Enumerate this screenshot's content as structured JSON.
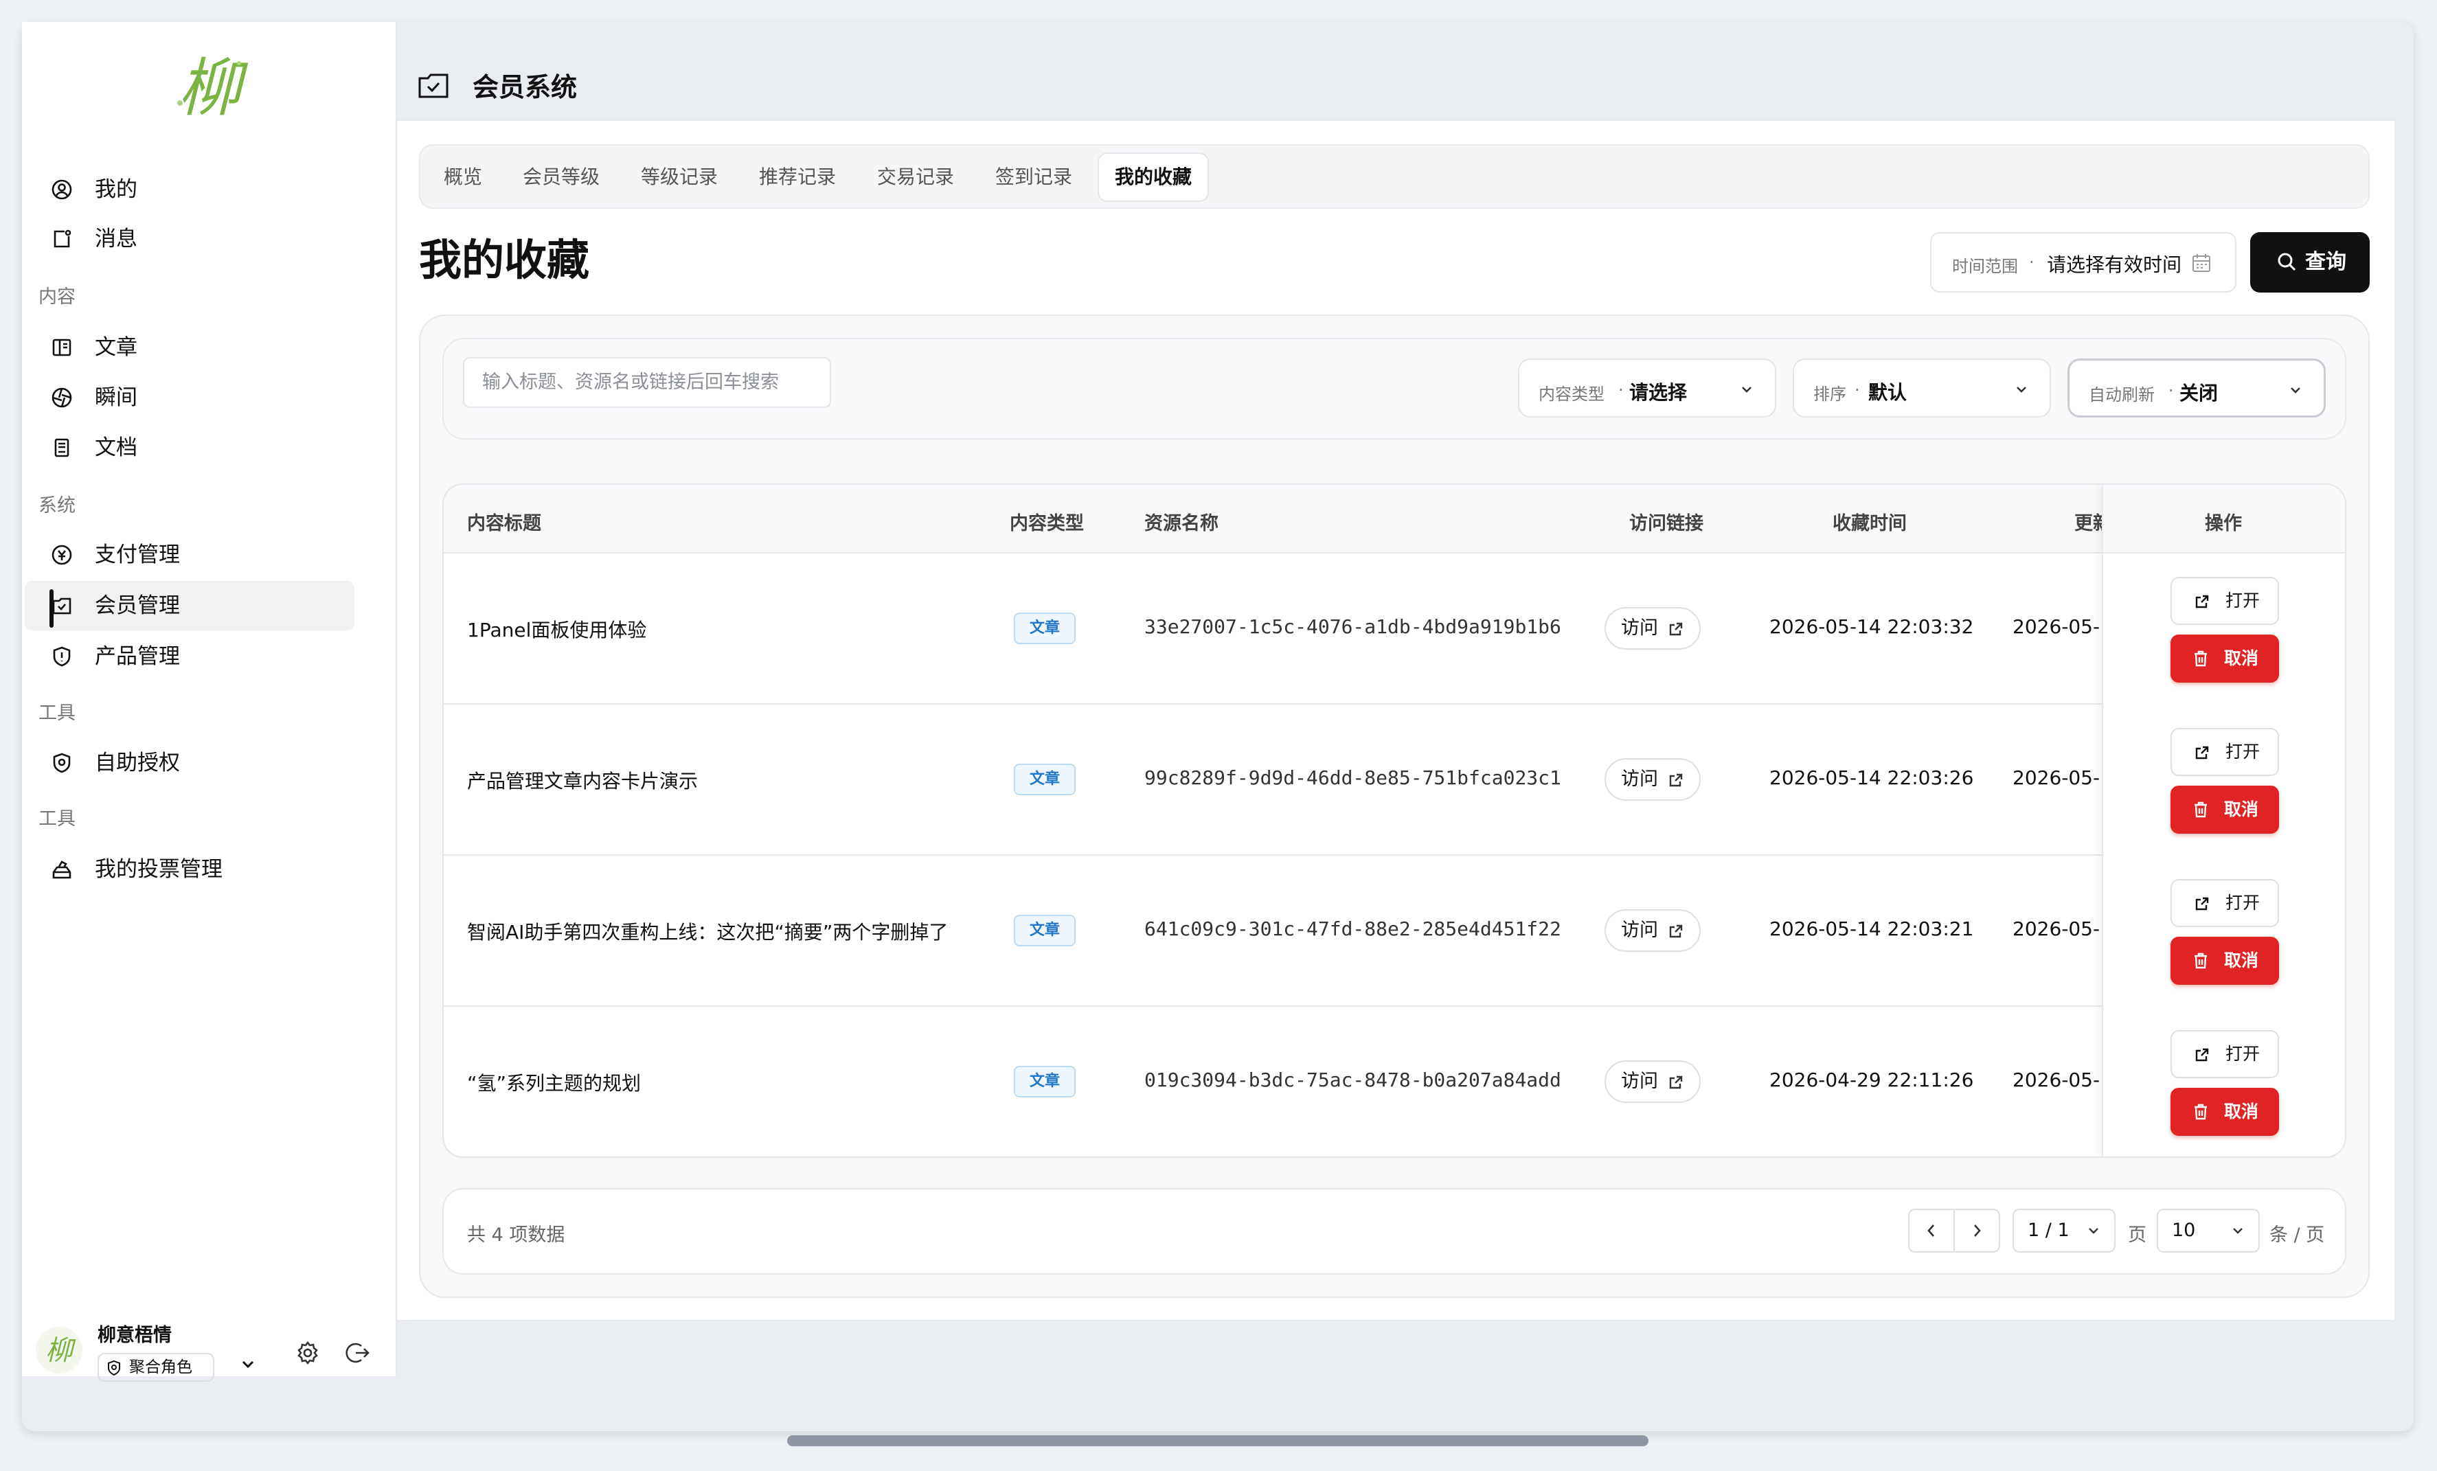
{
  "sidebar": {
    "logo_text": "柳",
    "items_top": [
      {
        "label": "我的",
        "icon": "user-circle-icon"
      },
      {
        "label": "消息",
        "icon": "message-icon"
      }
    ],
    "section_content": "内容",
    "items_content": [
      {
        "label": "文章",
        "icon": "book-open-icon"
      },
      {
        "label": "瞬间",
        "icon": "aperture-icon"
      },
      {
        "label": "文档",
        "icon": "document-icon"
      }
    ],
    "section_system": "系统",
    "items_system": [
      {
        "label": "支付管理",
        "icon": "payment-icon"
      },
      {
        "label": "会员管理",
        "icon": "member-icon",
        "active": true
      },
      {
        "label": "产品管理",
        "icon": "shield-icon"
      }
    ],
    "section_tools1": "工具",
    "items_tools1": [
      {
        "label": "自助授权",
        "icon": "shield-badge-icon"
      }
    ],
    "section_tools2": "工具",
    "items_tools2": [
      {
        "label": "我的投票管理",
        "icon": "vote-box-icon"
      }
    ],
    "user": {
      "name": "柳意梧情",
      "role": "聚合角色"
    }
  },
  "header": {
    "title": "会员系统"
  },
  "tabs": [
    "概览",
    "会员等级",
    "等级记录",
    "推荐记录",
    "交易记录",
    "签到记录",
    "我的收藏"
  ],
  "active_tab": "我的收藏",
  "page_title": "我的收藏",
  "time_range": {
    "label": "时间范围",
    "sep": "·",
    "placeholder": "请选择有效时间"
  },
  "query_label": "查询",
  "search_placeholder": "输入标题、资源名或链接后回车搜索",
  "filters": [
    {
      "label": "内容类型",
      "value": "请选择"
    },
    {
      "label": "排序",
      "value": "默认"
    },
    {
      "label": "自动刷新",
      "value": "关闭"
    }
  ],
  "table": {
    "columns": [
      "内容标题",
      "内容类型",
      "资源名称",
      "访问链接",
      "收藏时间",
      "更新",
      "操作"
    ],
    "rows": [
      {
        "title": "1Panel面板使用体验",
        "type": "文章",
        "resource": "33e27007-1c5c-4076-a1db-4bd9a919b1b6",
        "link": "访问",
        "time": "2026-05-14 22:03:32",
        "updated": "2026-05-"
      },
      {
        "title": "产品管理文章内容卡片演示",
        "type": "文章",
        "resource": "99c8289f-9d9d-46dd-8e85-751bfca023c1",
        "link": "访问",
        "time": "2026-05-14 22:03:26",
        "updated": "2026-05-"
      },
      {
        "title": "智阅AI助手第四次重构上线：这次把“摘要”两个字删掉了",
        "type": "文章",
        "resource": "641c09c9-301c-47fd-88e2-285e4d451f22",
        "link": "访问",
        "time": "2026-05-14 22:03:21",
        "updated": "2026-05-"
      },
      {
        "title": "“氢”系列主题的规划",
        "type": "文章",
        "resource": "019c3094-b3dc-75ac-8478-b0a207a84add",
        "link": "访问",
        "time": "2026-04-29 22:11:26",
        "updated": "2026-05-"
      }
    ],
    "open_label": "打开",
    "cancel_label": "取消"
  },
  "pagination": {
    "total": "共 4 项数据",
    "page": "1 / 1",
    "page_unit": "页",
    "page_size": "10",
    "size_unit": "条 / 页"
  },
  "colors": {
    "accent": "#111111",
    "danger": "#e02424",
    "badge": "#2176c7",
    "logo": "#7cb342"
  }
}
